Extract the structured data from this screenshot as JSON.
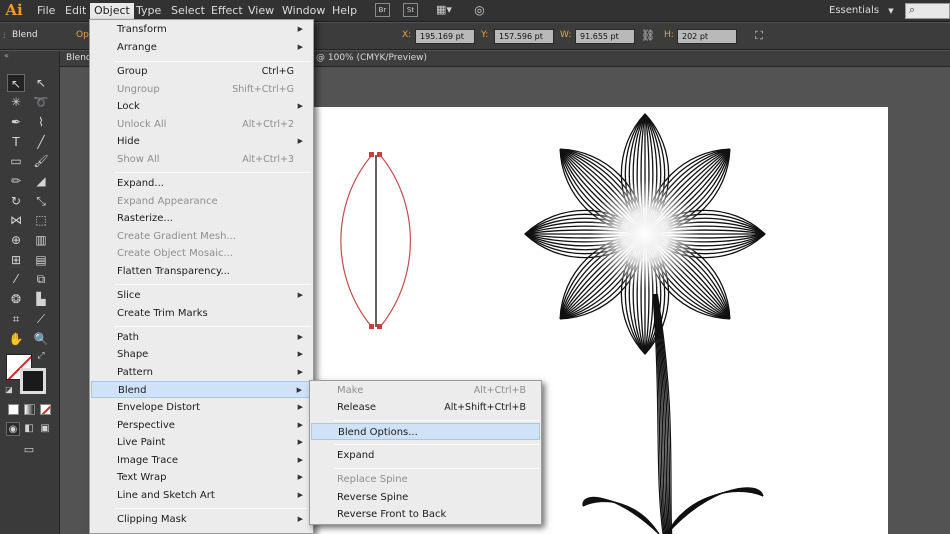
{
  "app": {
    "logo": "Ai"
  },
  "menubar": {
    "items": [
      "File",
      "Edit",
      "Object",
      "Type",
      "Select",
      "Effect",
      "View",
      "Window",
      "Help"
    ],
    "icons": [
      "Br",
      "St",
      "arrange-documents",
      "gpu-performance"
    ],
    "workspace": "Essentials"
  },
  "controlbar": {
    "selection_type": "Blend",
    "opacity_label": "Op",
    "x_label": "X:",
    "x_value": "195.169 pt",
    "y_label": "Y:",
    "y_value": "157.596 pt",
    "w_label": "W:",
    "w_value": "91.655 pt",
    "h_label": "H:",
    "h_value": "202 pt"
  },
  "document": {
    "tab_name": "Blend",
    "tab_info": "@ 100% (CMYK/Preview)"
  },
  "object_menu": {
    "items": [
      {
        "label": "Transform",
        "shortcut": "",
        "submenu": true,
        "disabled": false
      },
      {
        "label": "Arrange",
        "shortcut": "",
        "submenu": true,
        "disabled": false
      },
      {
        "label": "Group",
        "shortcut": "Ctrl+G",
        "submenu": false,
        "disabled": false
      },
      {
        "label": "Ungroup",
        "shortcut": "Shift+Ctrl+G",
        "submenu": false,
        "disabled": true
      },
      {
        "label": "Lock",
        "shortcut": "",
        "submenu": true,
        "disabled": false
      },
      {
        "label": "Unlock All",
        "shortcut": "Alt+Ctrl+2",
        "submenu": false,
        "disabled": true
      },
      {
        "label": "Hide",
        "shortcut": "",
        "submenu": true,
        "disabled": false
      },
      {
        "label": "Show All",
        "shortcut": "Alt+Ctrl+3",
        "submenu": false,
        "disabled": true
      },
      {
        "label": "Expand...",
        "shortcut": "",
        "submenu": false,
        "disabled": false
      },
      {
        "label": "Expand Appearance",
        "shortcut": "",
        "submenu": false,
        "disabled": true
      },
      {
        "label": "Rasterize...",
        "shortcut": "",
        "submenu": false,
        "disabled": false
      },
      {
        "label": "Create Gradient Mesh...",
        "shortcut": "",
        "submenu": false,
        "disabled": true
      },
      {
        "label": "Create Object Mosaic...",
        "shortcut": "",
        "submenu": false,
        "disabled": true
      },
      {
        "label": "Flatten Transparency...",
        "shortcut": "",
        "submenu": false,
        "disabled": false
      },
      {
        "label": "Slice",
        "shortcut": "",
        "submenu": true,
        "disabled": false
      },
      {
        "label": "Create Trim Marks",
        "shortcut": "",
        "submenu": false,
        "disabled": false
      },
      {
        "label": "Path",
        "shortcut": "",
        "submenu": true,
        "disabled": false
      },
      {
        "label": "Shape",
        "shortcut": "",
        "submenu": true,
        "disabled": false
      },
      {
        "label": "Pattern",
        "shortcut": "",
        "submenu": true,
        "disabled": false
      },
      {
        "label": "Blend",
        "shortcut": "",
        "submenu": true,
        "disabled": false
      },
      {
        "label": "Envelope Distort",
        "shortcut": "",
        "submenu": true,
        "disabled": false
      },
      {
        "label": "Perspective",
        "shortcut": "",
        "submenu": true,
        "disabled": false
      },
      {
        "label": "Live Paint",
        "shortcut": "",
        "submenu": true,
        "disabled": false
      },
      {
        "label": "Image Trace",
        "shortcut": "",
        "submenu": true,
        "disabled": false
      },
      {
        "label": "Text Wrap",
        "shortcut": "",
        "submenu": true,
        "disabled": false
      },
      {
        "label": "Line and Sketch Art",
        "shortcut": "",
        "submenu": true,
        "disabled": false
      },
      {
        "label": "Clipping Mask",
        "shortcut": "",
        "submenu": true,
        "disabled": false
      }
    ]
  },
  "blend_submenu": {
    "items": [
      {
        "label": "Make",
        "shortcut": "Alt+Ctrl+B",
        "disabled": true
      },
      {
        "label": "Release",
        "shortcut": "Alt+Shift+Ctrl+B",
        "disabled": false
      },
      {
        "label": "Blend Options...",
        "shortcut": "",
        "disabled": false
      },
      {
        "label": "Expand",
        "shortcut": "",
        "disabled": false
      },
      {
        "label": "Replace Spine",
        "shortcut": "",
        "disabled": true
      },
      {
        "label": "Reverse Spine",
        "shortcut": "",
        "disabled": false
      },
      {
        "label": "Reverse Front to Back",
        "shortcut": "",
        "disabled": false
      }
    ]
  },
  "colors": {
    "menubar_bg": "#323232",
    "panel_bg": "#3a3a3a",
    "canvas_bg": "#535353",
    "artboard_bg": "#ffffff",
    "menu_bg": "#ececec",
    "menu_highlight": "#cfe2f7",
    "accent_orange": "#f59b1a",
    "selection_red": "#d23b3b"
  }
}
